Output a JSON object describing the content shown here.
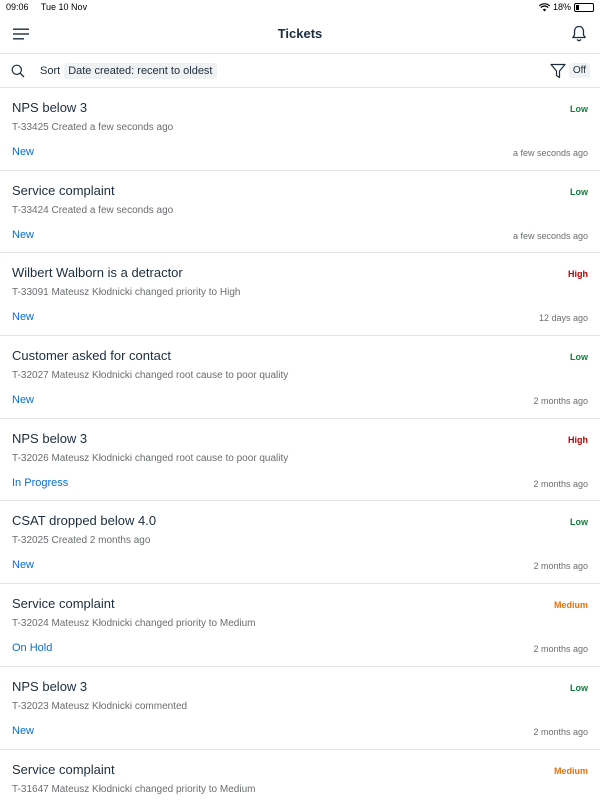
{
  "status_bar": {
    "time": "09:06",
    "date": "Tue 10 Nov",
    "battery": "18%",
    "battery_level": 0.18
  },
  "header": {
    "title": "Tickets"
  },
  "toolbar": {
    "sort_label": "Sort",
    "sort_value": "Date created: recent to oldest",
    "filter_state": "Off"
  },
  "colors": {
    "low": "#107e3e",
    "high": "#bb0000",
    "medium": "#e9730c",
    "link": "#0a6ed1"
  },
  "tickets": [
    {
      "title": "NPS below 3",
      "subtitle": "T-33425 Created a few seconds ago",
      "status": "New",
      "priority": "Low",
      "time": "a few seconds ago"
    },
    {
      "title": "Service complaint",
      "subtitle": "T-33424 Created a few seconds ago",
      "status": "New",
      "priority": "Low",
      "time": "a few seconds ago"
    },
    {
      "title": "Wilbert Walborn is a detractor",
      "subtitle": "T-33091 Mateusz Kłodnicki changed priority to High",
      "status": "New",
      "priority": "High",
      "time": "12 days ago"
    },
    {
      "title": "Customer asked for contact",
      "subtitle": "T-32027 Mateusz Kłodnicki changed root cause to poor quality",
      "status": "New",
      "priority": "Low",
      "time": "2 months ago"
    },
    {
      "title": "NPS below 3",
      "subtitle": "T-32026 Mateusz Kłodnicki changed root cause to poor quality",
      "status": "In Progress",
      "priority": "High",
      "time": "2 months ago"
    },
    {
      "title": "CSAT dropped below 4.0",
      "subtitle": "T-32025 Created 2 months ago",
      "status": "New",
      "priority": "Low",
      "time": "2 months ago"
    },
    {
      "title": "Service complaint",
      "subtitle": "T-32024 Mateusz Kłodnicki changed priority to Medium",
      "status": "On Hold",
      "priority": "Medium",
      "time": "2 months ago"
    },
    {
      "title": "NPS below 3",
      "subtitle": "T-32023 Mateusz Kłodnicki commented",
      "status": "New",
      "priority": "Low",
      "time": "2 months ago"
    },
    {
      "title": "Service complaint",
      "subtitle": "T-31647 Mateusz Kłodnicki changed priority to Medium",
      "status": "",
      "priority": "Medium",
      "time": ""
    }
  ]
}
